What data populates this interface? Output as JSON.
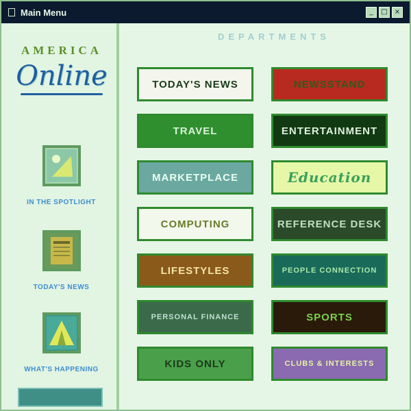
{
  "window": {
    "title": "Main Menu",
    "controls": [
      "_",
      "□",
      "×"
    ]
  },
  "sidebar": {
    "logo_top": "AMERICA",
    "logo_script": "Online",
    "items": [
      {
        "label": "IN THE SPOTLIGHT",
        "icon": "spotlight-icon"
      },
      {
        "label": "TODAY'S NEWS",
        "icon": "newspaper-icon"
      },
      {
        "label": "WHAT'S HAPPENING",
        "icon": "tent-icon"
      }
    ]
  },
  "main": {
    "heading": "DEPARTMENTS",
    "tiles": [
      {
        "label": "TODAY'S NEWS",
        "color": "#f4f6ee",
        "text_color": "#1a3a1a"
      },
      {
        "label": "NEWSSTAND",
        "color": "#b82a1f",
        "text_color": "#2e5a1e"
      },
      {
        "label": "TRAVEL",
        "color": "#2f8f2f",
        "text_color": "#d8f3d8"
      },
      {
        "label": "ENTERTAINMENT",
        "color": "#123a12",
        "text_color": "#e0f0e0"
      },
      {
        "label": "MARKETPLACE",
        "color": "#6aa8a0",
        "text_color": "#e8fff0"
      },
      {
        "label": "Education",
        "color": "#e6f7a8",
        "text_color": "#3aa05a"
      },
      {
        "label": "COMPUTING",
        "color": "#f2f8ec",
        "text_color": "#6a7a2a"
      },
      {
        "label": "REFERENCE DESK",
        "color": "#2a4a2a",
        "text_color": "#bfe0bf"
      },
      {
        "label": "LIFESTYLES",
        "color": "#8a5a1a",
        "text_color": "#f4e4a4"
      },
      {
        "label": "PEOPLE CONNECTION",
        "color": "#1a6a5a",
        "text_color": "#a8e8a8"
      },
      {
        "label": "PERSONAL FINANCE",
        "color": "#3a6a4a",
        "text_color": "#bfe0cf"
      },
      {
        "label": "SPORTS",
        "color": "#2a1a0a",
        "text_color": "#7ad04a"
      },
      {
        "label": "KIDS ONLY",
        "color": "#4aa04a",
        "text_color": "#1a3a1a"
      },
      {
        "label": "CLUBS & INTERESTS",
        "color": "#8a6ab0",
        "text_color": "#e4f4a4"
      }
    ]
  }
}
